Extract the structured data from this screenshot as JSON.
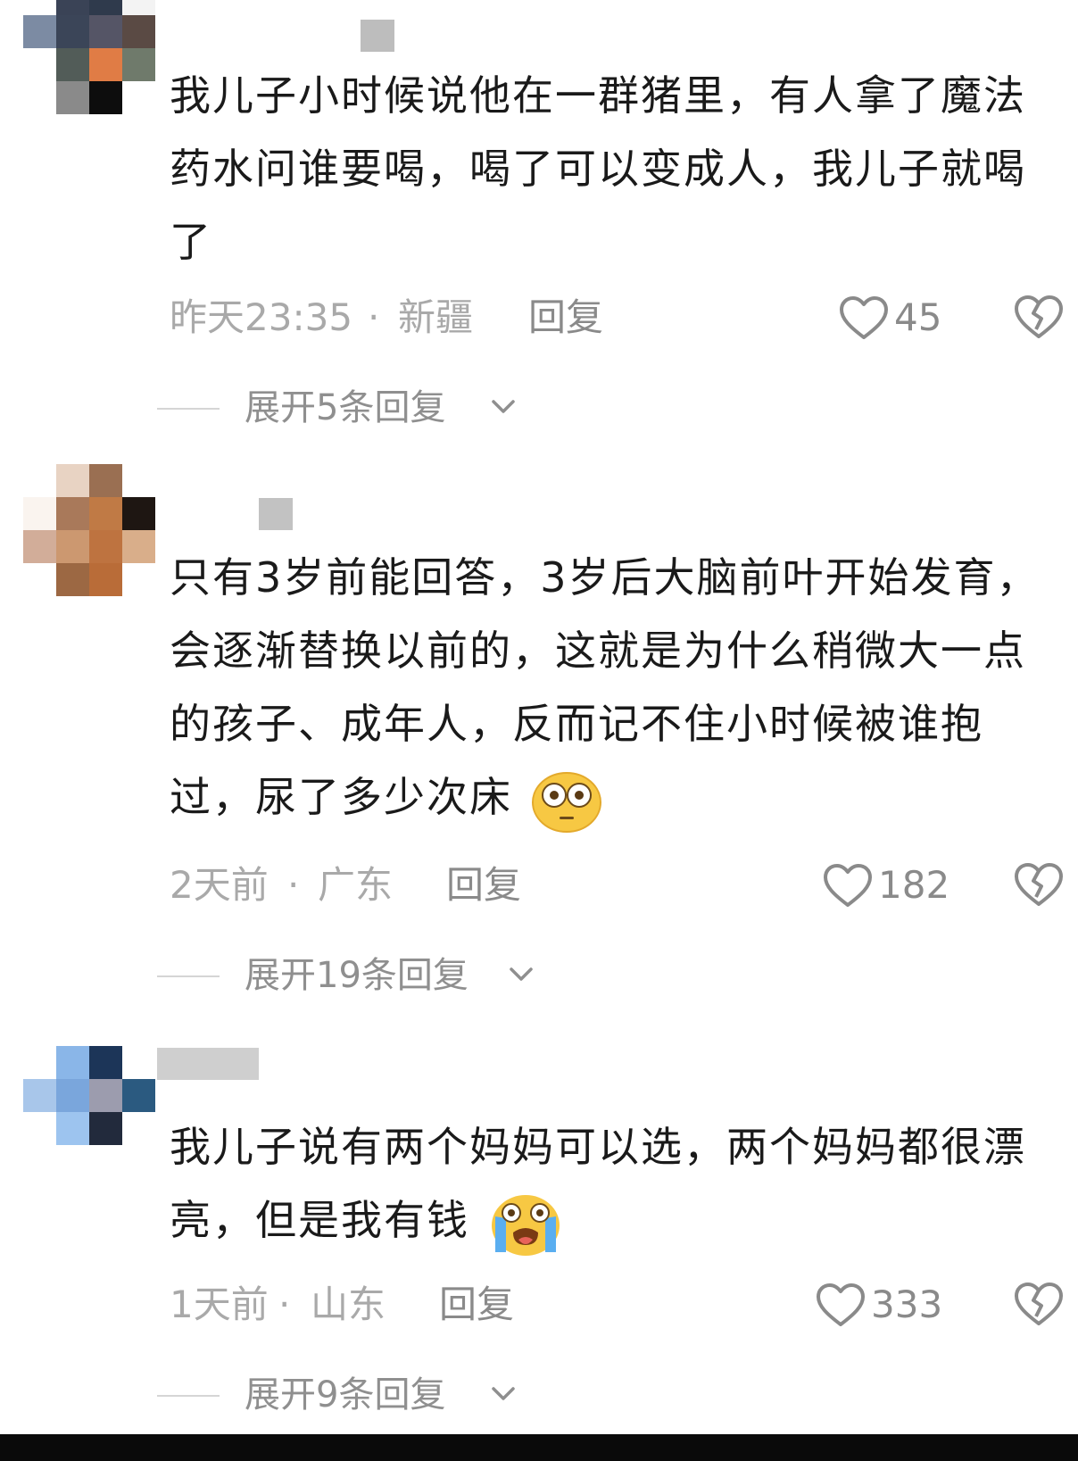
{
  "comments": [
    {
      "text": "我儿子小时候说他在一群猪里，有人拿了魔法药水问谁要喝，喝了可以变成人，我儿子就喝了",
      "time": "昨天23:35",
      "sep": "·",
      "location": "新疆",
      "reply_label": "回复",
      "likes": "45",
      "expand_label": "展开5条回复"
    },
    {
      "text": "只有3岁前能回答，3岁后大脑前叶开始发育，会逐渐替换以前的，这就是为什么稍微大一点的孩子、成年人，反而记不住小时候被谁抱过，尿了多少次床",
      "emoji": "flushed-face-emoji",
      "time": "2天前",
      "sep": "·",
      "location": "广东",
      "reply_label": "回复",
      "likes": "182",
      "expand_label": "展开19条回复"
    },
    {
      "text": "我儿子说有两个妈妈可以选，两个妈妈都很漂亮，但是我有钱",
      "emoji": "loudly-crying-face-emoji",
      "time": "1天前",
      "sep": "·",
      "location": "山东",
      "reply_label": "回复",
      "likes": "333",
      "expand_label": "展开9条回复"
    }
  ],
  "icons": {
    "like": "heart-outline-icon",
    "dislike": "broken-heart-icon",
    "expand": "chevron-down-icon"
  },
  "colors": {
    "text": "#1a1a1a",
    "meta": "#a9a9a9",
    "action": "#8a8a8a"
  }
}
